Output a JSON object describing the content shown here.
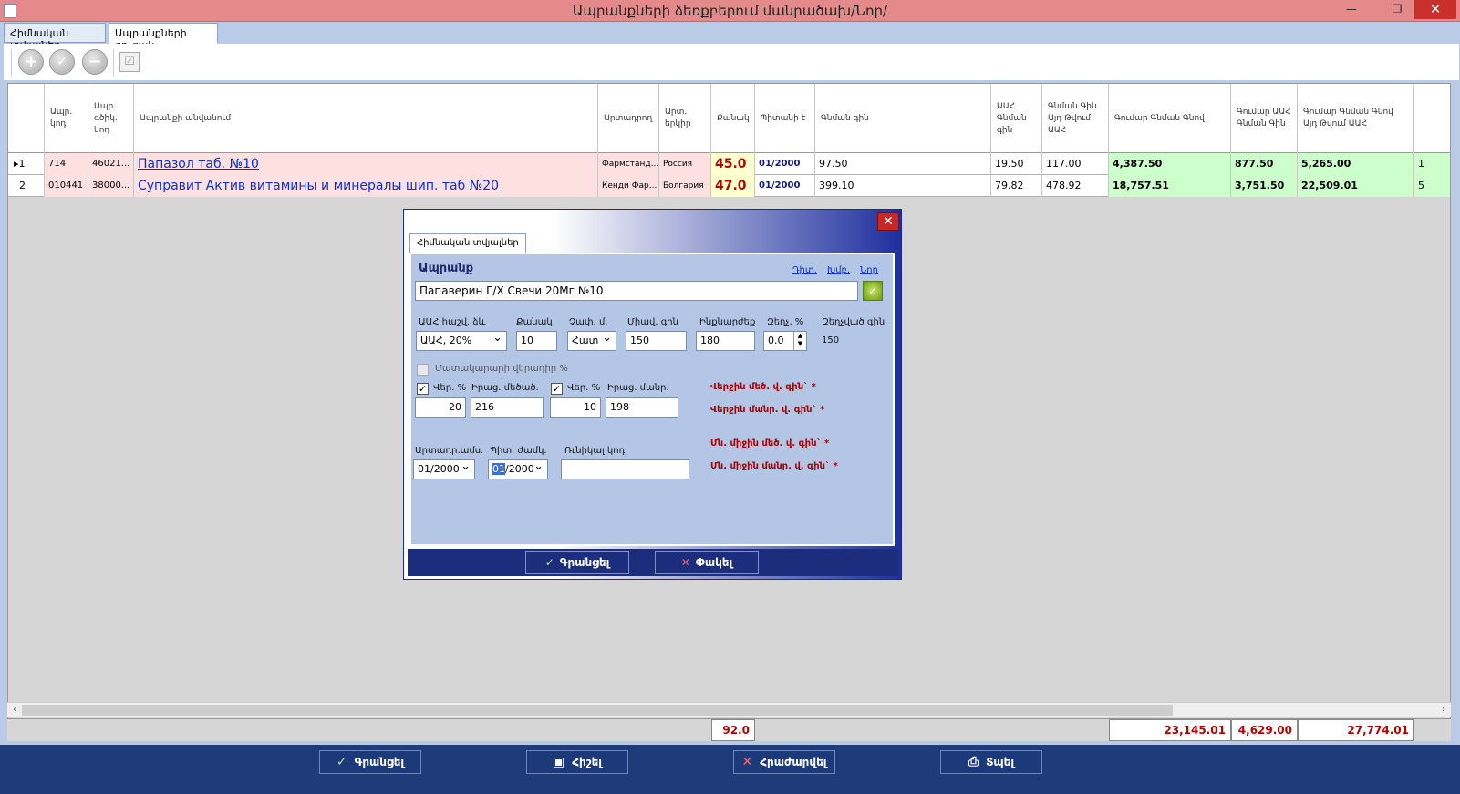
{
  "window": {
    "title": "Ապրանքների ձեռքբերում մանրածախ/Նոր/",
    "restore_glyph": "❐",
    "close_glyph": "✕"
  },
  "tabs": [
    "Հիմնական տվյալներ",
    "Ապրանքների ցուցակ"
  ],
  "toolbar": {
    "add": "+",
    "remove": "−"
  },
  "columns": [
    "",
    "Ապր. կոդ",
    "Ապր. գծիկ. կոդ",
    "Ապրանքի անվանում",
    "Արտադրող",
    "Արտ. երկիր",
    "Քանակ",
    "Պիտանի է",
    "Գնման գին",
    "ԱԱՀ Գնման գին",
    "Գնման Գին Այդ Թվում ԱԱՀ",
    "Գումար Գնման Գնով",
    "Գումար ԱԱՀ Գնման Գին",
    "Գումար Գնման Գնով Այդ Թվում ԱԱՀ"
  ],
  "rows": [
    {
      "num": "1",
      "code": "714",
      "barcode": "46021...",
      "name": "Папазол таб. №10",
      "producer": "Фармстанд...",
      "country": "Россия",
      "qty": "45.0",
      "expiry": "01/2000",
      "price": "97.50",
      "vat_price": "19.50",
      "price_with_vat": "117.00",
      "sum": "4,387.50",
      "sum_vat": "877.50",
      "sum_with_vat": "5,265.00",
      "extra": "1"
    },
    {
      "num": "2",
      "code": "010441",
      "barcode": "38000...",
      "name": "Супpавит Актив витамины и минералы шип. таб №20",
      "producer": "Кенди Фар...",
      "country": "Болгария",
      "qty": "47.0",
      "expiry": "01/2000",
      "price": "399.10",
      "vat_price": "79.82",
      "price_with_vat": "478.92",
      "sum": "18,757.51",
      "sum_vat": "3,751.50",
      "sum_with_vat": "22,509.01",
      "extra": "5"
    }
  ],
  "totals": {
    "qty": "92.0",
    "sum": "23,145.01",
    "sum_vat": "4,629.00",
    "sum_with_vat": "27,774.01"
  },
  "bottom_buttons": [
    "Գրանցել",
    "Հիշել",
    "Հրաժարվել",
    "Տպել"
  ],
  "modal": {
    "tab": "Հիմնական տվյալներ",
    "section_title": "Ապրանք",
    "links": [
      "Դիտ.",
      "Խմբ.",
      "Նոր"
    ],
    "product_value": "Папаверин Г/Х Свечи 20Мг №10",
    "labels": {
      "vat": "ԱԱՀ հաշվ. ձև",
      "qty": "Քանակ",
      "unit": "Չափ. մ.",
      "unit_price": "Միավ. գին",
      "cost": "Ինքնարժեք",
      "discount": "Զեղչ, %",
      "discounted_price": "Զեղչված գին",
      "supplier_markup": "Մատակարարի վերադիր %",
      "markup1": "Վեր. %",
      "sale_big": "Իրաց. մեծած.",
      "markup2": "Վեր. %",
      "sale_small": "Իրաց. մանր.",
      "prod_date": "Արտադր.ամս.",
      "exp_date": "Պիտ. ժամկ.",
      "series": "Ռւնիկալ կոդ"
    },
    "values": {
      "vat": "ԱԱՀ, 20%",
      "qty": "10",
      "unit": "Հատ",
      "unit_price": "150",
      "cost": "180",
      "discount": "0.0",
      "discounted_price": "150",
      "markup1": "20",
      "sale_big": "216",
      "markup2": "10",
      "sale_small": "198",
      "prod_date": "01/2000",
      "exp_date_sel": "01",
      "exp_date_rest": "/2000",
      "series": ""
    },
    "info": [
      "Վերջին մեծ. վ. գին` *",
      "Վերջին մանր. վ. գին` *",
      "Մն. միջին մեծ. վ. գին` *",
      "Մն. միջին մանր. վ. գին` *"
    ],
    "buttons": [
      "Գրանցել",
      "Փակել"
    ]
  },
  "colors": {
    "title_bar": "#e58a8a",
    "row_pink": "#fde0e0",
    "row_green": "#ccffcc",
    "total_red": "#b30000",
    "bottom_bar": "#1f3c7a"
  }
}
